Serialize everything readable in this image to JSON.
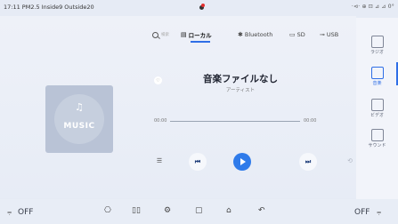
{
  "status": {
    "left": "17:11 PM2.5 Inside9 Outside20",
    "right": "·⊲· ⊕ ⊡ ⊿ ⊿ 0°"
  },
  "source_tabs": {
    "search_placeholder": "検索",
    "local": "ローカル",
    "bluetooth": "Bluetooth",
    "sd": "SD",
    "usb": "USB"
  },
  "sidebar": {
    "items": [
      {
        "label": "ラジオ",
        "icon": "radio-icon"
      },
      {
        "label": "音楽",
        "icon": "music-icon",
        "active": true
      },
      {
        "label": "ビデオ",
        "icon": "video-icon"
      },
      {
        "label": "サウンド",
        "icon": "sound-icon"
      }
    ]
  },
  "album": {
    "text": "MUSIC"
  },
  "track": {
    "title": "音楽ファイルなし",
    "artist": "アーティスト",
    "time_current": "00:00",
    "time_total": "00:00",
    "progress": 0
  },
  "bottom": {
    "left_fan": "OFF",
    "right_fan": "OFF"
  },
  "colors": {
    "accent": "#2f7bea",
    "background": "#e6ebf5"
  }
}
